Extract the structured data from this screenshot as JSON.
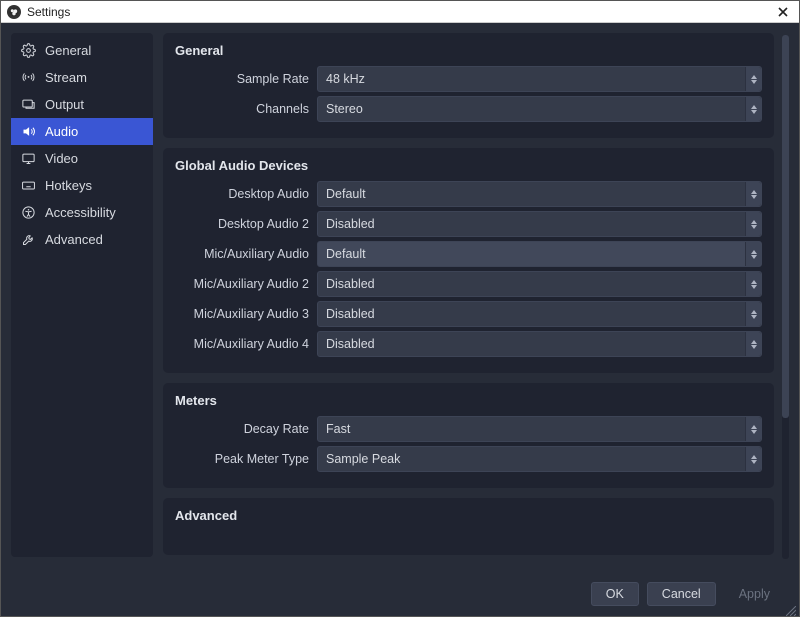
{
  "window": {
    "title": "Settings"
  },
  "sidebar": {
    "items": [
      {
        "label": "General"
      },
      {
        "label": "Stream"
      },
      {
        "label": "Output"
      },
      {
        "label": "Audio"
      },
      {
        "label": "Video"
      },
      {
        "label": "Hotkeys"
      },
      {
        "label": "Accessibility"
      },
      {
        "label": "Advanced"
      }
    ],
    "active_index": 3
  },
  "groups": {
    "general": {
      "title": "General",
      "sample_rate": {
        "label": "Sample Rate",
        "value": "48 kHz"
      },
      "channels": {
        "label": "Channels",
        "value": "Stereo"
      }
    },
    "devices": {
      "title": "Global Audio Devices",
      "desktop_audio": {
        "label": "Desktop Audio",
        "value": "Default"
      },
      "desktop_audio_2": {
        "label": "Desktop Audio 2",
        "value": "Disabled"
      },
      "mic_aux": {
        "label": "Mic/Auxiliary Audio",
        "value": "Default"
      },
      "mic_aux_2": {
        "label": "Mic/Auxiliary Audio 2",
        "value": "Disabled"
      },
      "mic_aux_3": {
        "label": "Mic/Auxiliary Audio 3",
        "value": "Disabled"
      },
      "mic_aux_4": {
        "label": "Mic/Auxiliary Audio 4",
        "value": "Disabled"
      }
    },
    "meters": {
      "title": "Meters",
      "decay_rate": {
        "label": "Decay Rate",
        "value": "Fast"
      },
      "peak_meter_type": {
        "label": "Peak Meter Type",
        "value": "Sample Peak"
      }
    },
    "advanced": {
      "title": "Advanced"
    }
  },
  "footer": {
    "ok": "OK",
    "cancel": "Cancel",
    "apply": "Apply"
  }
}
